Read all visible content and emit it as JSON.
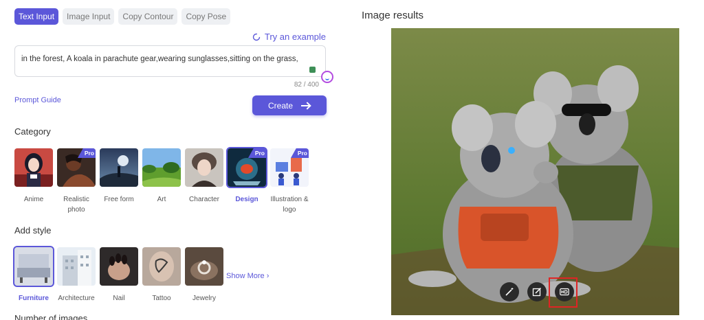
{
  "tabs": [
    "Text Input",
    "Image Input",
    "Copy Contour",
    "Copy Pose"
  ],
  "try_example": "Try an example",
  "prompt": {
    "value": "in the forest, A koala in parachute gear,wearing sunglasses,sitting on the grass,",
    "counter": "82 / 400"
  },
  "prompt_guide": "Prompt Guide",
  "create_label": "Create",
  "category": {
    "title": "Category",
    "items": [
      {
        "label": "Anime",
        "pro": false
      },
      {
        "label": "Realistic photo",
        "pro": true
      },
      {
        "label": "Free form",
        "pro": false
      },
      {
        "label": "Art",
        "pro": false
      },
      {
        "label": "Character",
        "pro": false
      },
      {
        "label": "Design",
        "pro": true,
        "selected": true
      },
      {
        "label": "Illustration & logo",
        "pro": true
      }
    ]
  },
  "style": {
    "title": "Add style",
    "items": [
      {
        "label": "Furniture",
        "selected": true
      },
      {
        "label": "Architecture"
      },
      {
        "label": "Nail"
      },
      {
        "label": "Tattoo"
      },
      {
        "label": "Jewelry"
      }
    ],
    "show_more": "Show More"
  },
  "pro_badge": "Pro",
  "number_title": "Number of images",
  "results": {
    "title": "Image results",
    "actions": [
      "magic-wand-icon",
      "edit-icon",
      "hd-icon"
    ]
  },
  "colors": {
    "accent": "#5b57d9",
    "highlight": "#e02424"
  }
}
